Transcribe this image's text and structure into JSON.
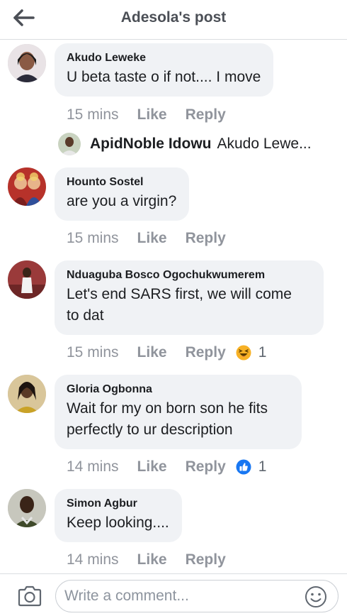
{
  "header": {
    "title": "Adesola's post",
    "back_icon": "arrow-left-icon"
  },
  "comments": [
    {
      "author": "Akudo Leweke",
      "text": "U beta taste o if not.... I move",
      "time": "15 mins",
      "like": "Like",
      "reply": "Reply",
      "reaction": null
    },
    {
      "author": "Hounto Sostel",
      "text": "are you a virgin?",
      "time": "15 mins",
      "like": "Like",
      "reply": "Reply",
      "reaction": null
    },
    {
      "author": "Nduaguba Bosco Ogochukwumerem",
      "text": "Let's end SARS first, we will come\nto dat",
      "time": "15 mins",
      "like": "Like",
      "reply": "Reply",
      "reaction": {
        "icon": "haha-emoji-icon",
        "count": "1"
      }
    },
    {
      "author": "Gloria Ogbonna",
      "text": "Wait for my on born son he fits\nperfectly to ur description",
      "time": "14 mins",
      "like": "Like",
      "reply": "Reply",
      "reaction": {
        "icon": "like-emoji-icon",
        "count": "1"
      }
    },
    {
      "author": "Simon Agbur",
      "text": "Keep looking....",
      "time": "14 mins",
      "like": "Like",
      "reply": "Reply",
      "reaction": null
    }
  ],
  "reply_preview": {
    "author": "ApidNoble Idowu",
    "text": "Akudo Lewe..."
  },
  "composer": {
    "placeholder": "Write a comment...",
    "camera_icon": "camera-icon",
    "emoji_icon": "smiley-icon"
  },
  "colors": {
    "bubble": "#f0f2f5",
    "meta_text": "#90949c",
    "like_blue": "#1877f2",
    "haha_yellow": "#f7b125"
  }
}
